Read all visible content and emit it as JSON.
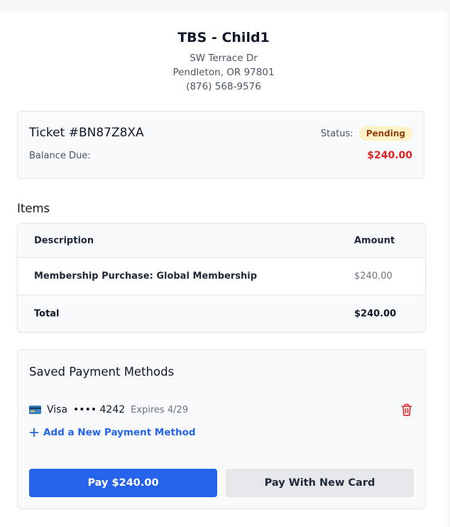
{
  "header": {
    "name": "TBS - Child1",
    "address_line1": "SW Terrace Dr",
    "address_line2": "Pendleton, OR 97801",
    "phone": "(876) 568-9576"
  },
  "ticket": {
    "title": "Ticket #BN87Z8XA",
    "status_label": "Status:",
    "status": "Pending",
    "balance_label": "Balance Due:",
    "balance": "$240.00"
  },
  "items": {
    "heading": "Items",
    "columns": [
      "Description",
      "Amount"
    ],
    "rows": [
      {
        "description": "Membership Purchase: Global Membership",
        "amount": "$240.00"
      }
    ],
    "total_label": "Total",
    "total": "$240.00"
  },
  "payment": {
    "heading": "Saved Payment Methods",
    "saved": {
      "icon": "credit-card-icon",
      "brand": "Visa",
      "mask": "•••• 4242",
      "expires": "Expires 4/29"
    },
    "add_label": "Add a New Payment Method",
    "pay_button": "Pay $240.00",
    "new_card_button": "Pay With New Card"
  },
  "colors": {
    "primary": "#2563eb",
    "danger": "#dc2626",
    "badge_bg": "#fef3c7",
    "badge_text": "#92400e"
  }
}
